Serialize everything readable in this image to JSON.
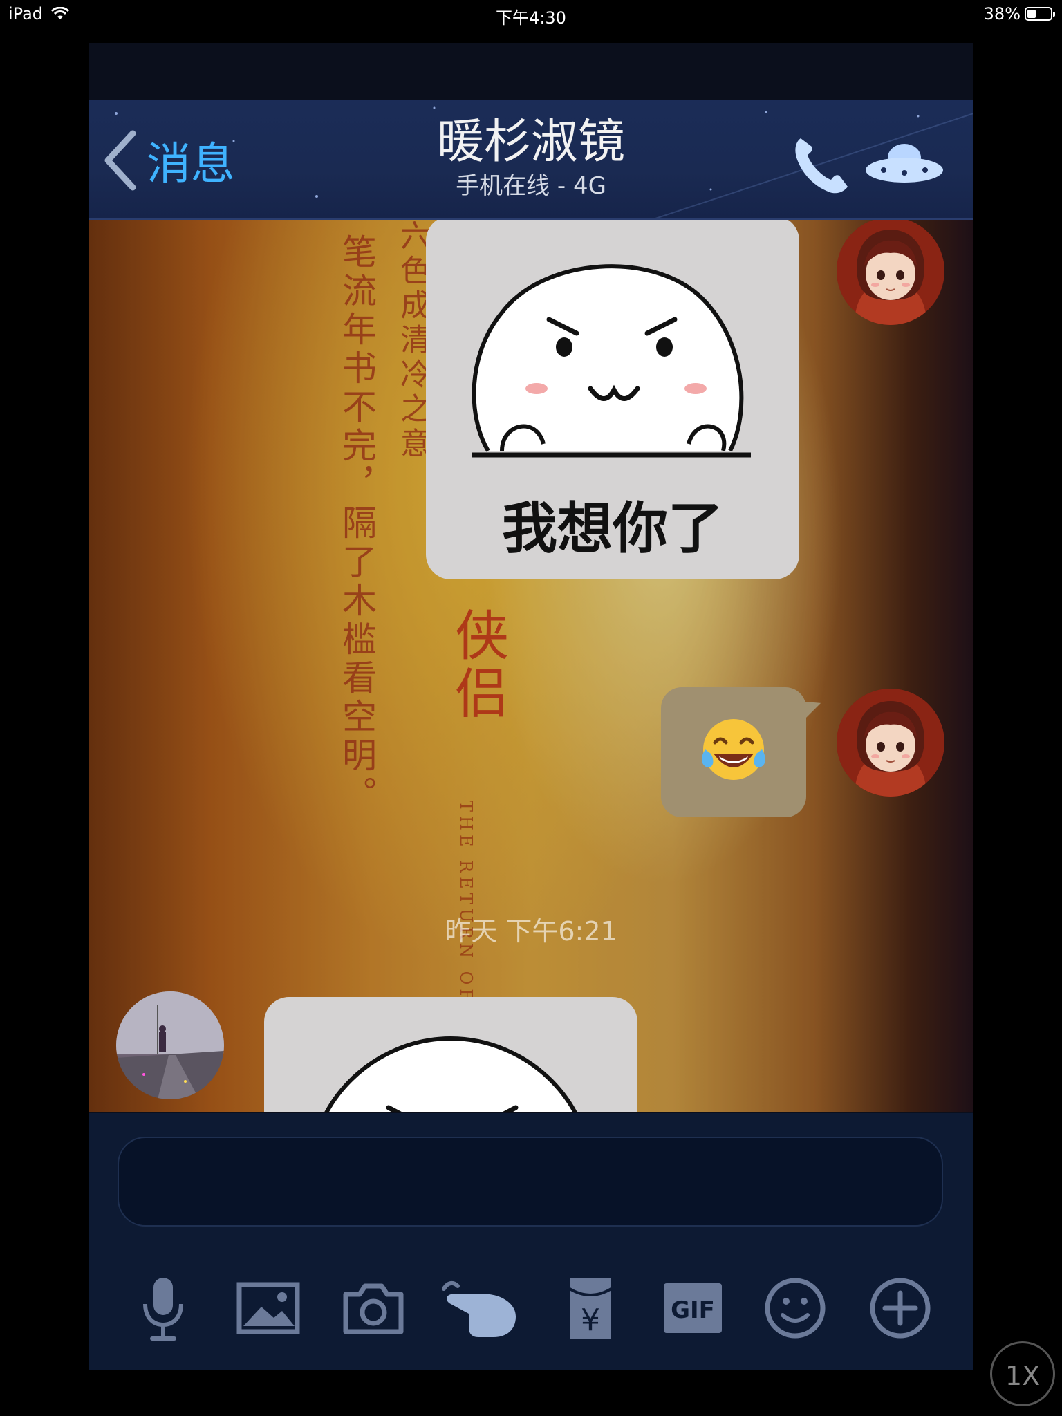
{
  "status_bar": {
    "device": "iPad",
    "time": "下午4:30",
    "battery": "38%",
    "battery_level": 0.38
  },
  "nav": {
    "back_label": "消息",
    "title": "暖杉淑镜",
    "subtitle": "手机在线 - 4G"
  },
  "messages": [
    {
      "sender": "me",
      "type": "sticker",
      "text": "我想你了"
    },
    {
      "sender": "me",
      "type": "emoji",
      "emoji": "😂"
    },
    {
      "type": "timestamp",
      "text": "昨天 下午6:21"
    },
    {
      "sender": "other",
      "type": "sticker",
      "text": ""
    }
  ],
  "background_text": {
    "line1": "笔流年书不完，隔了木槛看空明。",
    "line2": "六色成清冷之意",
    "line3": "侠侣",
    "line4": "THE RETURN OF T"
  },
  "input": {
    "value": "",
    "placeholder": ""
  },
  "toolbar": {
    "items": [
      "microphone-icon",
      "image-icon",
      "camera-icon",
      "poke-hand-icon",
      "red-packet-icon",
      "gif-icon",
      "smiley-icon",
      "plus-icon"
    ],
    "gif_label": "GIF",
    "red_packet_symbol": "¥"
  },
  "zoom": {
    "label": "1X"
  },
  "colors": {
    "accent": "#3fb3ff",
    "nav_bg": "#1b2c57",
    "toolbar_bg": "#0d1a33",
    "icon": "#6b7a99"
  }
}
